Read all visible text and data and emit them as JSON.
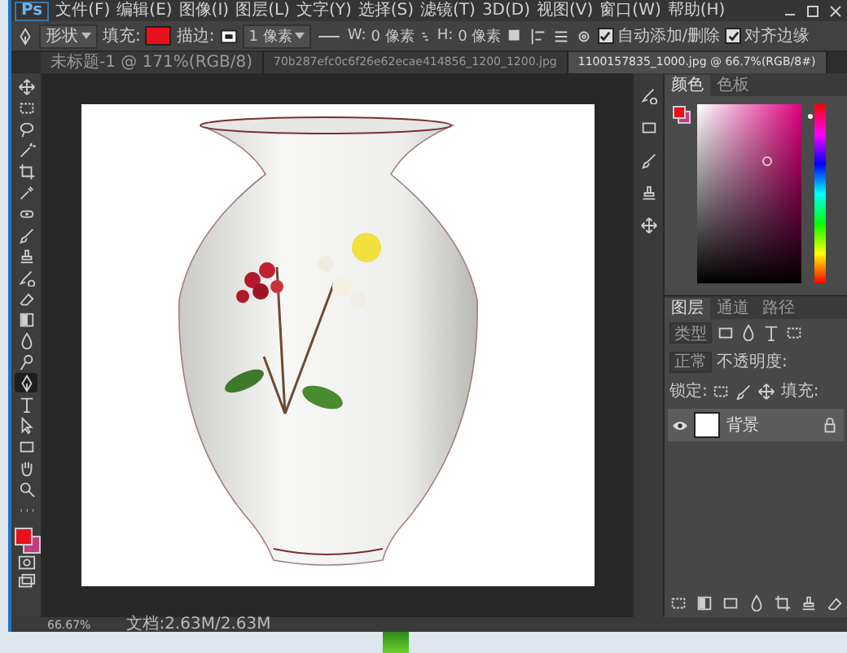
{
  "app": {
    "logo": "Ps"
  },
  "menu": [
    "文件(F)",
    "编辑(E)",
    "图像(I)",
    "图层(L)",
    "文字(Y)",
    "选择(S)",
    "滤镜(T)",
    "3D(D)",
    "视图(V)",
    "窗口(W)",
    "帮助(H)"
  ],
  "options_bar": {
    "tool_mode": "形状",
    "fill_label": "填充:",
    "stroke_label": "描边:",
    "stroke_width": "1 像素",
    "w_label": "W:",
    "w_value": "0 像素",
    "h_label": "H:",
    "h_value": "0 像素",
    "checkboxes": [
      {
        "label": "自动添加/删除",
        "checked": true
      },
      {
        "label": "对齐边缘",
        "checked": true
      }
    ]
  },
  "doc_tabs": [
    {
      "label": "未标题-1 @ 171%(RGB/8)",
      "selected": false
    },
    {
      "label": "70b287efc0c6f26e62ecae414856_1200_1200.jpg",
      "selected": false
    },
    {
      "label": "1100157835_1000.jpg @ 66.7%(RGB/8#)",
      "selected": true
    }
  ],
  "tools": [
    {
      "kind": "move",
      "selected": false
    },
    {
      "kind": "marquee",
      "selected": false
    },
    {
      "kind": "lasso",
      "selected": false
    },
    {
      "kind": "wand",
      "selected": false
    },
    {
      "kind": "crop",
      "selected": false
    },
    {
      "kind": "eyedropper",
      "selected": false
    },
    {
      "kind": "heal",
      "selected": false
    },
    {
      "kind": "brush",
      "selected": false
    },
    {
      "kind": "stamp",
      "selected": false
    },
    {
      "kind": "history",
      "selected": false
    },
    {
      "kind": "eraser",
      "selected": false
    },
    {
      "kind": "gradient",
      "selected": false
    },
    {
      "kind": "blur",
      "selected": false
    },
    {
      "kind": "dodge",
      "selected": false
    },
    {
      "kind": "pen",
      "selected": true
    },
    {
      "kind": "type",
      "selected": false
    },
    {
      "kind": "path",
      "selected": false
    },
    {
      "kind": "rect",
      "selected": false
    },
    {
      "kind": "hand",
      "selected": false
    },
    {
      "kind": "zoom",
      "selected": false
    },
    {
      "kind": "more",
      "selected": false
    }
  ],
  "color_panel": {
    "tabs": [
      {
        "label": "颜色",
        "selected": true
      },
      {
        "label": "色板",
        "selected": false
      }
    ],
    "hue_slider": {
      "level": 0.95
    }
  },
  "layers_panel": {
    "tabs": [
      {
        "label": "图层",
        "selected": true
      },
      {
        "label": "通道",
        "selected": false
      },
      {
        "label": "路径",
        "selected": false
      }
    ],
    "filter": "类型",
    "blend_mode": "正常",
    "opacity_label": "不透明度:",
    "lock_label": "锁定:",
    "fill_label": "填充:",
    "layers": [
      {
        "name": "背景",
        "visible": true,
        "selected": true,
        "locked": true
      }
    ]
  },
  "status_bar": {
    "zoom": "66.67%",
    "doc_size": "文档:2.63M/2.63M"
  }
}
